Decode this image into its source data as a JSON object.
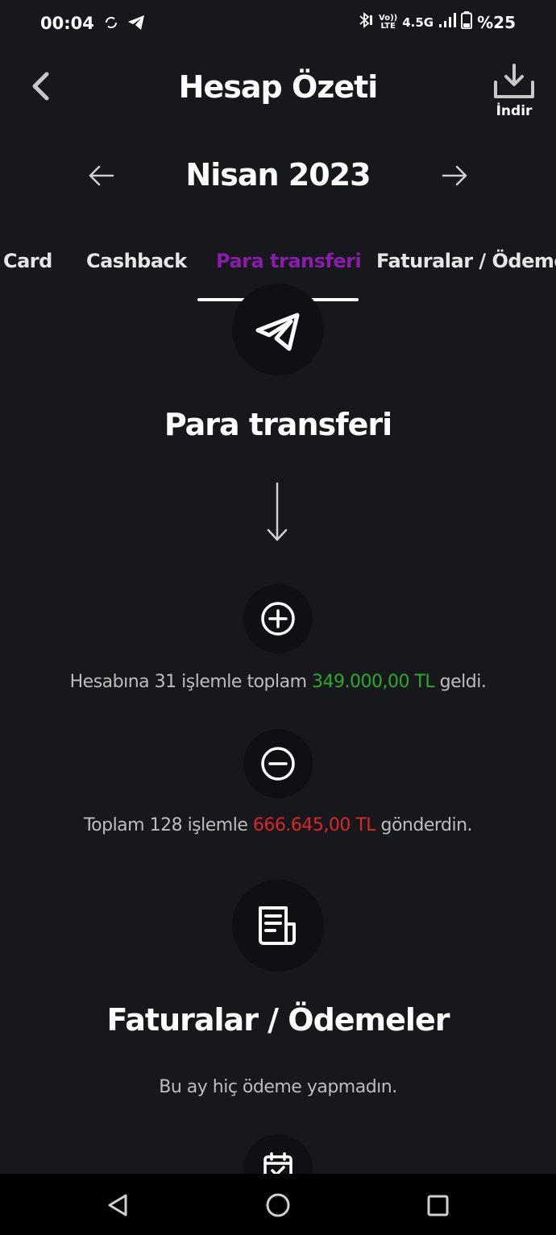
{
  "status_bar": {
    "time": "00:04",
    "network": "4.5G",
    "lte_top": "Vo))",
    "lte_bottom": "LTE",
    "battery": "%25",
    "icons": [
      "sync-icon",
      "telegram-icon",
      "bluetooth-icon",
      "signal-icon",
      "battery-icon"
    ]
  },
  "header": {
    "title": "Hesap Özeti",
    "download_label": "İndir"
  },
  "month_nav": {
    "label": "Nisan 2023"
  },
  "tabs": [
    {
      "label": "Card",
      "active": false
    },
    {
      "label": "Cashback",
      "active": false
    },
    {
      "label": "Para transferi",
      "active": true
    },
    {
      "label": "Faturalar / Ödemeler",
      "active": false
    }
  ],
  "transfer_section": {
    "title": "Para transferi",
    "incoming": {
      "prefix": "Hesabına 31 işlemle toplam ",
      "amount": "349.000,00 TL",
      "suffix": " geldi."
    },
    "outgoing": {
      "prefix": "Toplam 128 işlemle ",
      "amount": "666.645,00 TL",
      "suffix": " gönderdin."
    }
  },
  "bills_section": {
    "title": "Faturalar / Ödemeler",
    "text": "Bu ay hiç ödeme yapmadın."
  },
  "colors": {
    "background": "#17181c",
    "accent": "#8a1cab",
    "incoming": "#2ea82e",
    "outgoing": "#d92626"
  }
}
